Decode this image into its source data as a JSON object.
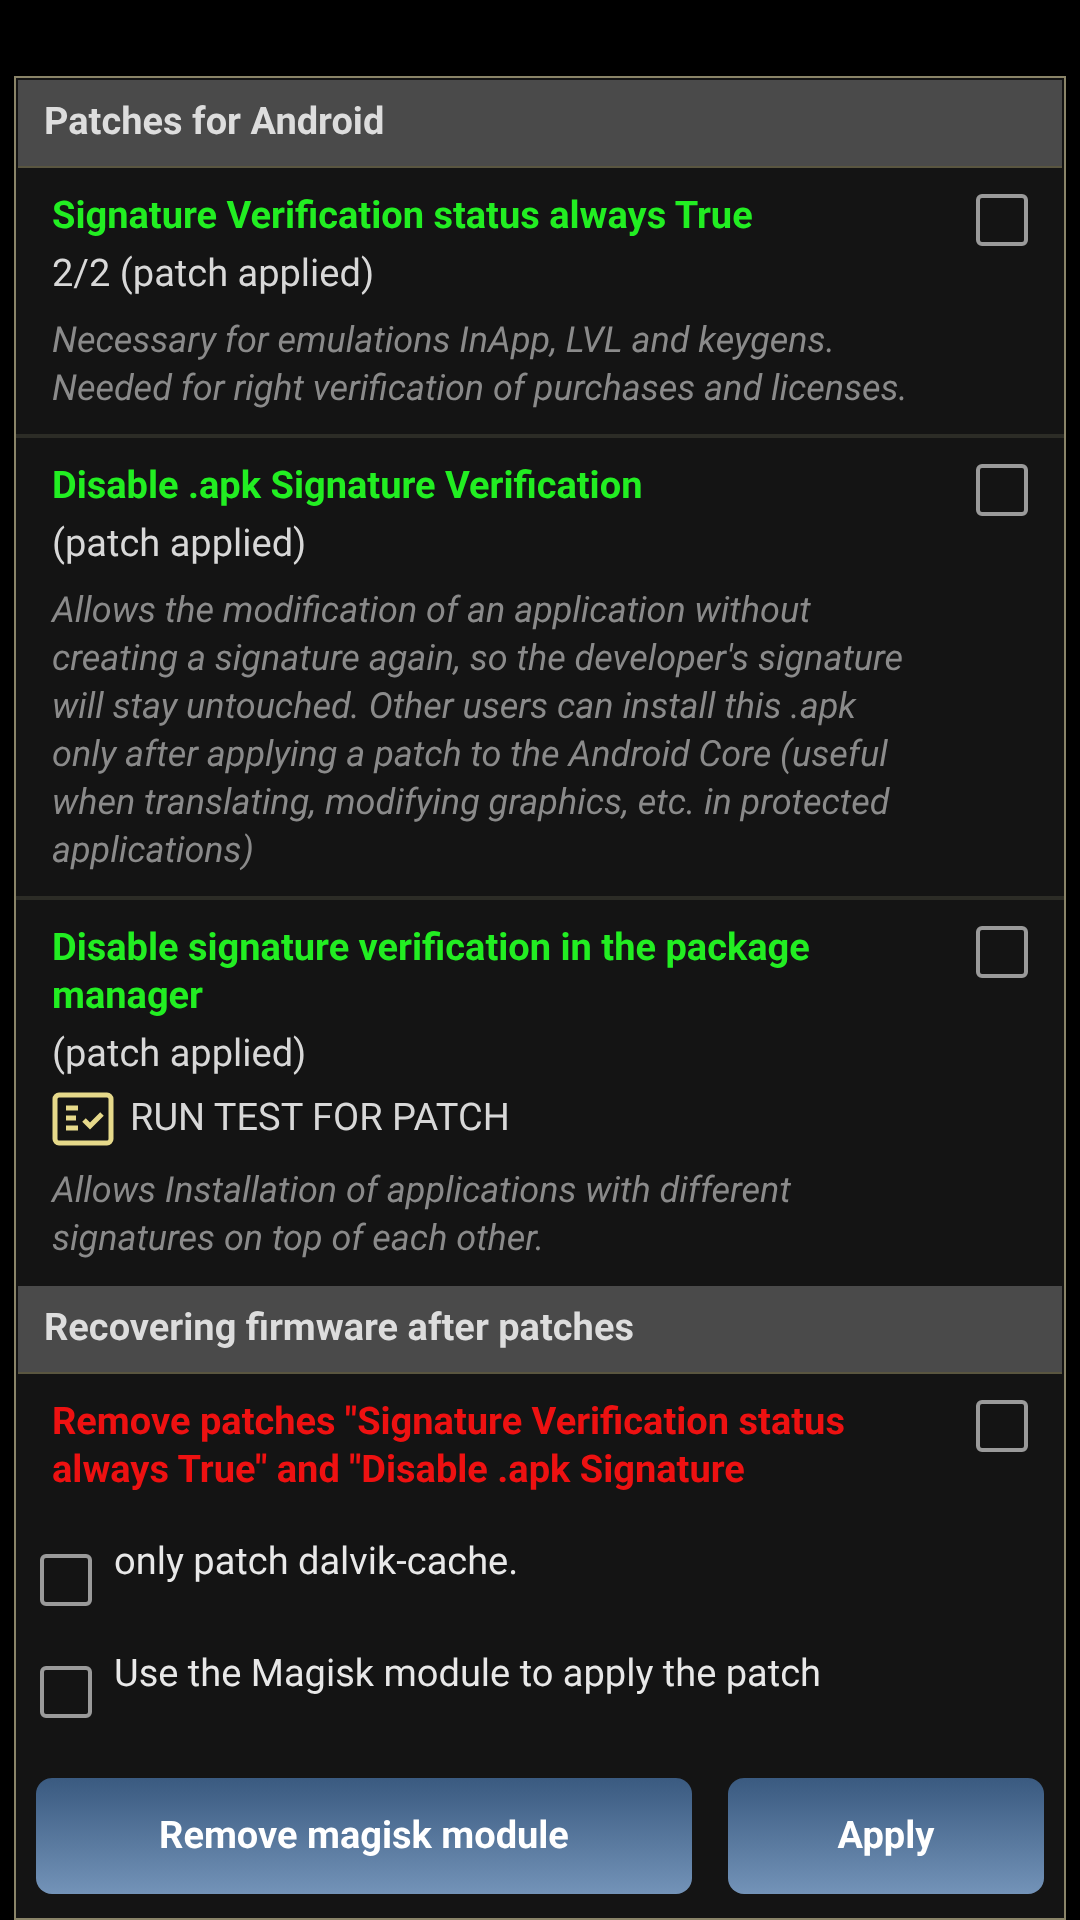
{
  "sections": [
    {
      "title": "Patches for Android",
      "items": [
        {
          "kind": "patch",
          "title": "Signature Verification status always True",
          "status": "2/2 (patch applied)",
          "description": "Necessary for emulations InApp, LVL and keygens. Needed for right verification of purchases and licenses.",
          "checked": false
        },
        {
          "kind": "patch",
          "title": "Disable .apk Signature Verification",
          "status": "(patch applied)",
          "description": "Allows the modification of an application without creating a signature again, so the developer's signature will stay untouched. Other users can install this .apk only after applying a patch to the Android Core (useful when translating, modifying graphics, etc. in protected applications)",
          "checked": false
        },
        {
          "kind": "patch",
          "title": "Disable signature verification in the package manager",
          "status": "(patch applied)",
          "test_button": "RUN TEST FOR PATCH",
          "description": "Allows Installation of applications with different signatures on top of each other.",
          "checked": false
        }
      ]
    },
    {
      "title": "Recovering firmware after patches",
      "items": [
        {
          "kind": "remove",
          "title": "Remove patches \"Signature Verification status always True\" and \"Disable .apk Signature",
          "checked": false
        }
      ]
    }
  ],
  "options": [
    {
      "label": "only patch dalvik-cache.",
      "checked": false
    },
    {
      "label": "Use the Magisk module to apply the patch",
      "checked": false
    }
  ],
  "buttons": [
    "Remove magisk module",
    "Apply"
  ]
}
